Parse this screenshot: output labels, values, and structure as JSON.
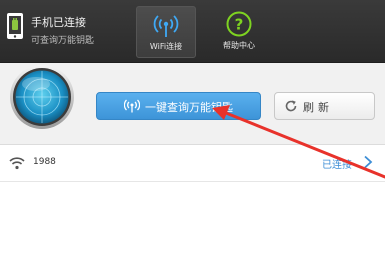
{
  "status": {
    "title": "手机已连接",
    "subtitle": "可查询万能钥匙"
  },
  "nav": {
    "tabs": [
      {
        "label": "WiFi连接",
        "icon": "wifi-icon"
      },
      {
        "label": "帮助中心",
        "icon": "help-icon"
      }
    ]
  },
  "hero": {
    "key_button_label": "一键查询万能钥匙",
    "refresh_label": "刷新"
  },
  "networks": [
    {
      "name": "1988",
      "status": "已连接"
    }
  ],
  "colors": {
    "accent": "#3d94d8",
    "topbar": "#2e2e2e",
    "help_green": "#7ed321",
    "annotation": "#e8322b"
  }
}
